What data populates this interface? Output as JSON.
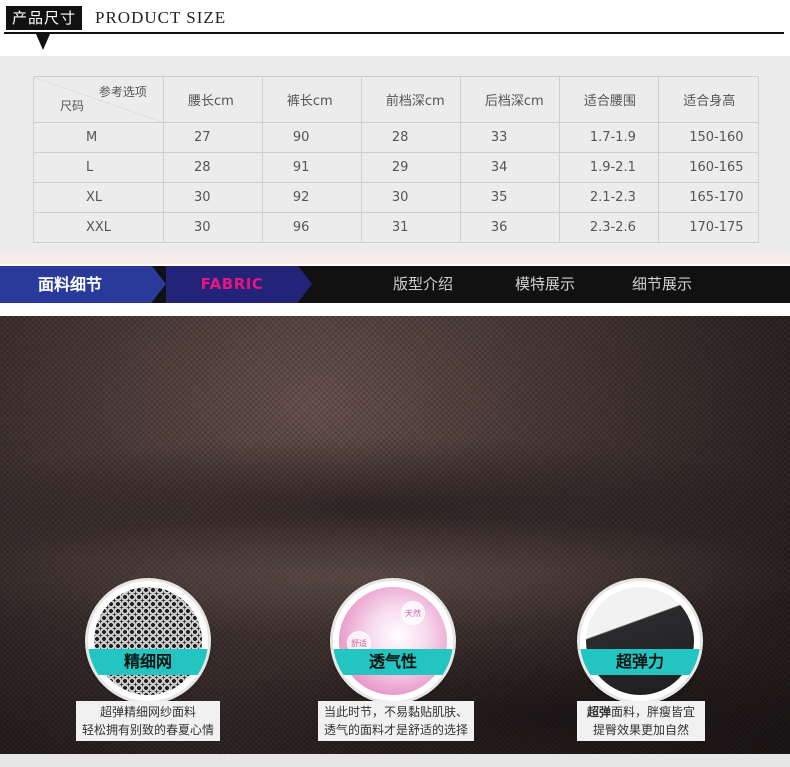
{
  "header": {
    "cn_title": "产品尺寸",
    "en_title": "PRODUCT SIZE"
  },
  "size_table": {
    "corner_top": "参考选项",
    "corner_bottom": "尺码",
    "columns": [
      "腰长cm",
      "裤长cm",
      "前档深cm",
      "后档深cm",
      "适合腰围",
      "适合身高"
    ],
    "rows": [
      {
        "size": "M",
        "values": [
          "27",
          "90",
          "28",
          "33",
          "1.7-1.9",
          "150-160"
        ]
      },
      {
        "size": "L",
        "values": [
          "28",
          "91",
          "29",
          "34",
          "1.9-2.1",
          "160-165"
        ]
      },
      {
        "size": "XL",
        "values": [
          "30",
          "92",
          "30",
          "35",
          "2.1-2.3",
          "165-170"
        ]
      },
      {
        "size": "XXL",
        "values": [
          "30",
          "96",
          "31",
          "36",
          "2.3-2.6",
          "170-175"
        ]
      }
    ]
  },
  "nav": {
    "active": "面料细节",
    "active_en": "FABRIC",
    "items": [
      "版型介绍",
      "模特展示",
      "细节展示"
    ]
  },
  "features": [
    {
      "label": "精细网",
      "caption_line1": "超弹精细网纱面料",
      "caption_line2": "轻松拥有别致的春夏心情"
    },
    {
      "label": "透气性",
      "caption_line1": "当此时节，不易黏贴肌肤、",
      "caption_line2": "透气的面料才是舒适的选择",
      "bubbles": [
        "天然",
        "舒适"
      ]
    },
    {
      "label": "超弹力",
      "caption_line1_bold": "超弹",
      "caption_line1_rest": "面料，胖瘦皆宜",
      "caption_line2": "提臀效果更加自然"
    }
  ],
  "colors": {
    "nav_active_bg": "#2a3a9a",
    "fabric_accent": "#e6157f",
    "badge_label_bg": "#22c5c0"
  }
}
